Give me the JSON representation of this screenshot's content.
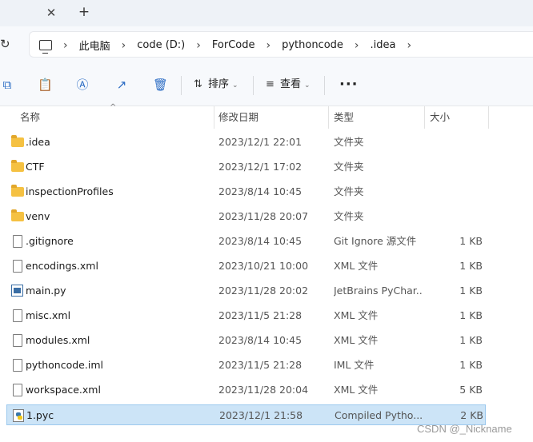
{
  "tabbar": {
    "close_glyph": "✕",
    "new_tab_glyph": "+"
  },
  "address": {
    "refresh_glyph": "↻",
    "sep_glyph": "›",
    "crumbs": [
      "此电脑",
      "code (D:)",
      "ForCode",
      "pythoncode",
      ".idea"
    ]
  },
  "commands": {
    "copy_glyph": "⧉",
    "paste_glyph": "📋",
    "rename_glyph": "Ⓐ",
    "share_glyph": "↗",
    "delete_glyph": "🗑",
    "sort_glyph": "⇅",
    "sort_label": "排序",
    "view_glyph": "≡",
    "view_label": "查看",
    "caret_glyph": "⌄",
    "more_glyph": "···"
  },
  "columns": {
    "name": "名称",
    "modified": "修改日期",
    "type": "类型",
    "size": "大小",
    "sort_arrow": "^"
  },
  "files": [
    {
      "name": ".idea",
      "date": "2023/12/1 22:01",
      "type": "文件夹",
      "size": "",
      "icon": "folder-icon"
    },
    {
      "name": "CTF",
      "date": "2023/12/1 17:02",
      "type": "文件夹",
      "size": "",
      "icon": "folder-icon"
    },
    {
      "name": "inspectionProfiles",
      "date": "2023/8/14 10:45",
      "type": "文件夹",
      "size": "",
      "icon": "folder-icon"
    },
    {
      "name": "venv",
      "date": "2023/11/28 20:07",
      "type": "文件夹",
      "size": "",
      "icon": "folder-icon"
    },
    {
      "name": ".gitignore",
      "date": "2023/8/14 10:45",
      "type": "Git Ignore 源文件",
      "size": "1 KB",
      "icon": "file-icon"
    },
    {
      "name": "encodings.xml",
      "date": "2023/10/21 10:00",
      "type": "XML 文件",
      "size": "1 KB",
      "icon": "file-icon"
    },
    {
      "name": "main.py",
      "date": "2023/11/28 20:02",
      "type": "JetBrains PyChar...",
      "size": "1 KB",
      "icon": "python-file-icon"
    },
    {
      "name": "misc.xml",
      "date": "2023/11/5 21:28",
      "type": "XML 文件",
      "size": "1 KB",
      "icon": "file-icon"
    },
    {
      "name": "modules.xml",
      "date": "2023/8/14 10:45",
      "type": "XML 文件",
      "size": "1 KB",
      "icon": "file-icon"
    },
    {
      "name": "pythoncode.iml",
      "date": "2023/11/5 21:28",
      "type": "IML 文件",
      "size": "1 KB",
      "icon": "file-icon"
    },
    {
      "name": "workspace.xml",
      "date": "2023/11/28 20:04",
      "type": "XML 文件",
      "size": "5 KB",
      "icon": "file-icon"
    },
    {
      "name": "1.pyc",
      "date": "2023/12/1 21:58",
      "type": "Compiled Pytho...",
      "size": "2 KB",
      "icon": "pyc-file-icon"
    }
  ],
  "watermark": "CSDN @_Nickname"
}
